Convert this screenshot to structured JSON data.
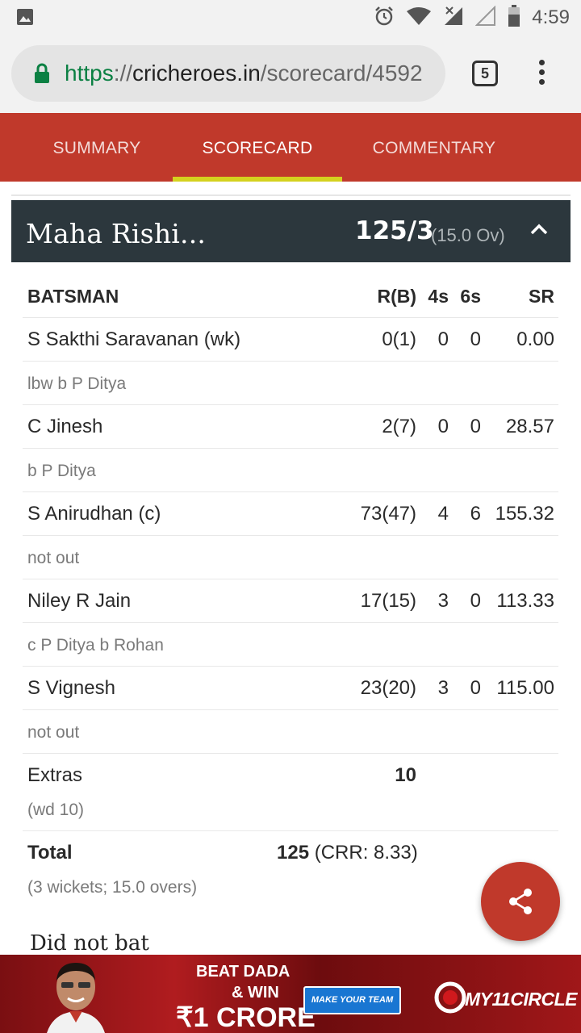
{
  "status_bar": {
    "time": "4:59",
    "icons": [
      "image-icon",
      "alarm-icon",
      "wifi-icon",
      "signal-icon",
      "signal-empty-icon",
      "battery-icon"
    ]
  },
  "browser": {
    "url_scheme": "https",
    "url_sep": "://",
    "url_host": "cricheroes.in",
    "url_path": "/scorecard/4592",
    "tab_count": "5"
  },
  "nav": {
    "tabs": [
      {
        "label": "SUMMARY",
        "active": false
      },
      {
        "label": "SCORECARD",
        "active": true
      },
      {
        "label": "COMMENTARY",
        "active": false
      }
    ]
  },
  "innings": {
    "team": "Maha Rishi...",
    "score": "125/3",
    "overs": "(15.0 Ov)"
  },
  "batting": {
    "headers": {
      "batsman": "BATSMAN",
      "rb": "R(B)",
      "fours": "4s",
      "sixes": "6s",
      "sr": "SR"
    },
    "rows": [
      {
        "name": "S Sakthi Saravanan (wk)",
        "rb": "0(1)",
        "fours": "0",
        "sixes": "0",
        "sr": "0.00",
        "dismissal": "lbw b P Ditya"
      },
      {
        "name": "C Jinesh",
        "rb": "2(7)",
        "fours": "0",
        "sixes": "0",
        "sr": "28.57",
        "dismissal": "b P Ditya"
      },
      {
        "name": "S Anirudhan (c)",
        "rb": "73(47)",
        "fours": "4",
        "sixes": "6",
        "sr": "155.32",
        "dismissal": "not out"
      },
      {
        "name": "Niley R Jain",
        "rb": "17(15)",
        "fours": "3",
        "sixes": "0",
        "sr": "113.33",
        "dismissal": "c P Ditya b Rohan"
      },
      {
        "name": "S Vignesh",
        "rb": "23(20)",
        "fours": "3",
        "sixes": "0",
        "sr": "115.00",
        "dismissal": "not out"
      }
    ],
    "extras": {
      "label": "Extras",
      "value": "10",
      "detail": "(wd 10)"
    },
    "total": {
      "label": "Total",
      "value": "125",
      "crr": "(CRR: 8.33)",
      "detail": "(3 wickets; 15.0 overs)"
    },
    "did_not_bat": "Did not bat"
  },
  "ad": {
    "line1": "BEAT DADA",
    "line2": "& WIN",
    "line3": "₹1 CRORE",
    "cta": "MAKE YOUR TEAM",
    "brand": "MY11CIRCLE"
  },
  "colors": {
    "nav_red": "#c0392b",
    "header_dark": "#2c373d",
    "tab_indicator": "#d4d11e",
    "lock_green": "#0b8043"
  }
}
